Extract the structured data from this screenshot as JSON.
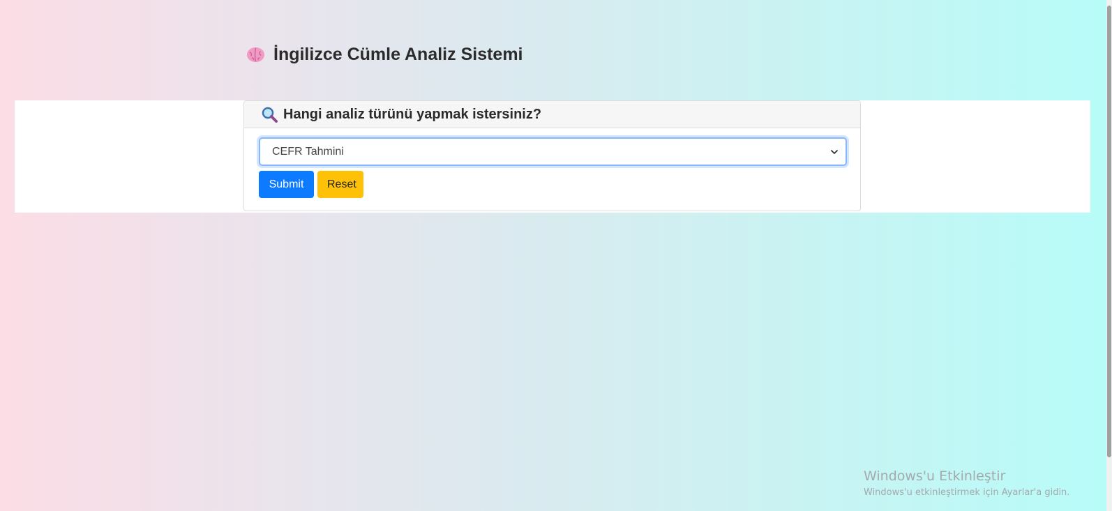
{
  "header": {
    "title": "İngilizce Cümle Analiz Sistemi",
    "icon": "brain-icon"
  },
  "card": {
    "header_title": "Hangi analiz türünü yapmak istersiniz?",
    "header_icon": "magnifier-icon",
    "select": {
      "selected_value": "CEFR Tahmini"
    },
    "buttons": {
      "submit_label": "Submit",
      "reset_label": "Reset"
    }
  },
  "watermark": {
    "title": "Windows'u Etkinleştir",
    "subtitle": "Windows'u etkinleştirmek için Ayarlar'a gidin."
  },
  "colors": {
    "submit": "#0d7bff",
    "reset": "#ffc107",
    "gradient_left": "#fcdde6",
    "gradient_right": "#b7fcf8"
  }
}
